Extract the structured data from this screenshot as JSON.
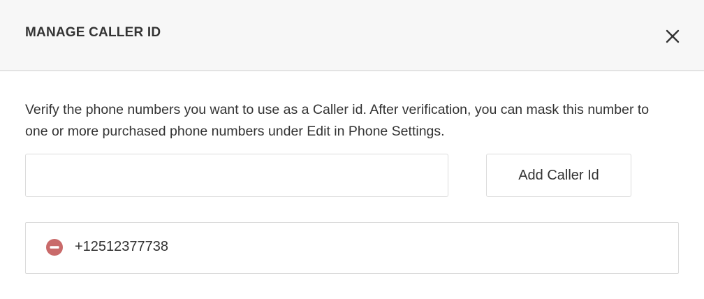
{
  "dialog": {
    "title": "MANAGE CALLER ID",
    "close_icon": "close-icon"
  },
  "description": "Verify the phone numbers you want to use as a Caller id. After verification, you can mask this number to one or more purchased phone numbers under Edit in Phone Settings.",
  "phone_input": {
    "value": "",
    "placeholder": ""
  },
  "add_button": {
    "label": "Add Caller Id"
  },
  "caller_ids": [
    {
      "number": "+12512377738",
      "remove_icon": "remove-circle-icon"
    }
  ],
  "colors": {
    "header_bg": "#f7f7f7",
    "remove_icon": "#c96a6a",
    "border": "#dcdcdc",
    "text": "#333333"
  }
}
